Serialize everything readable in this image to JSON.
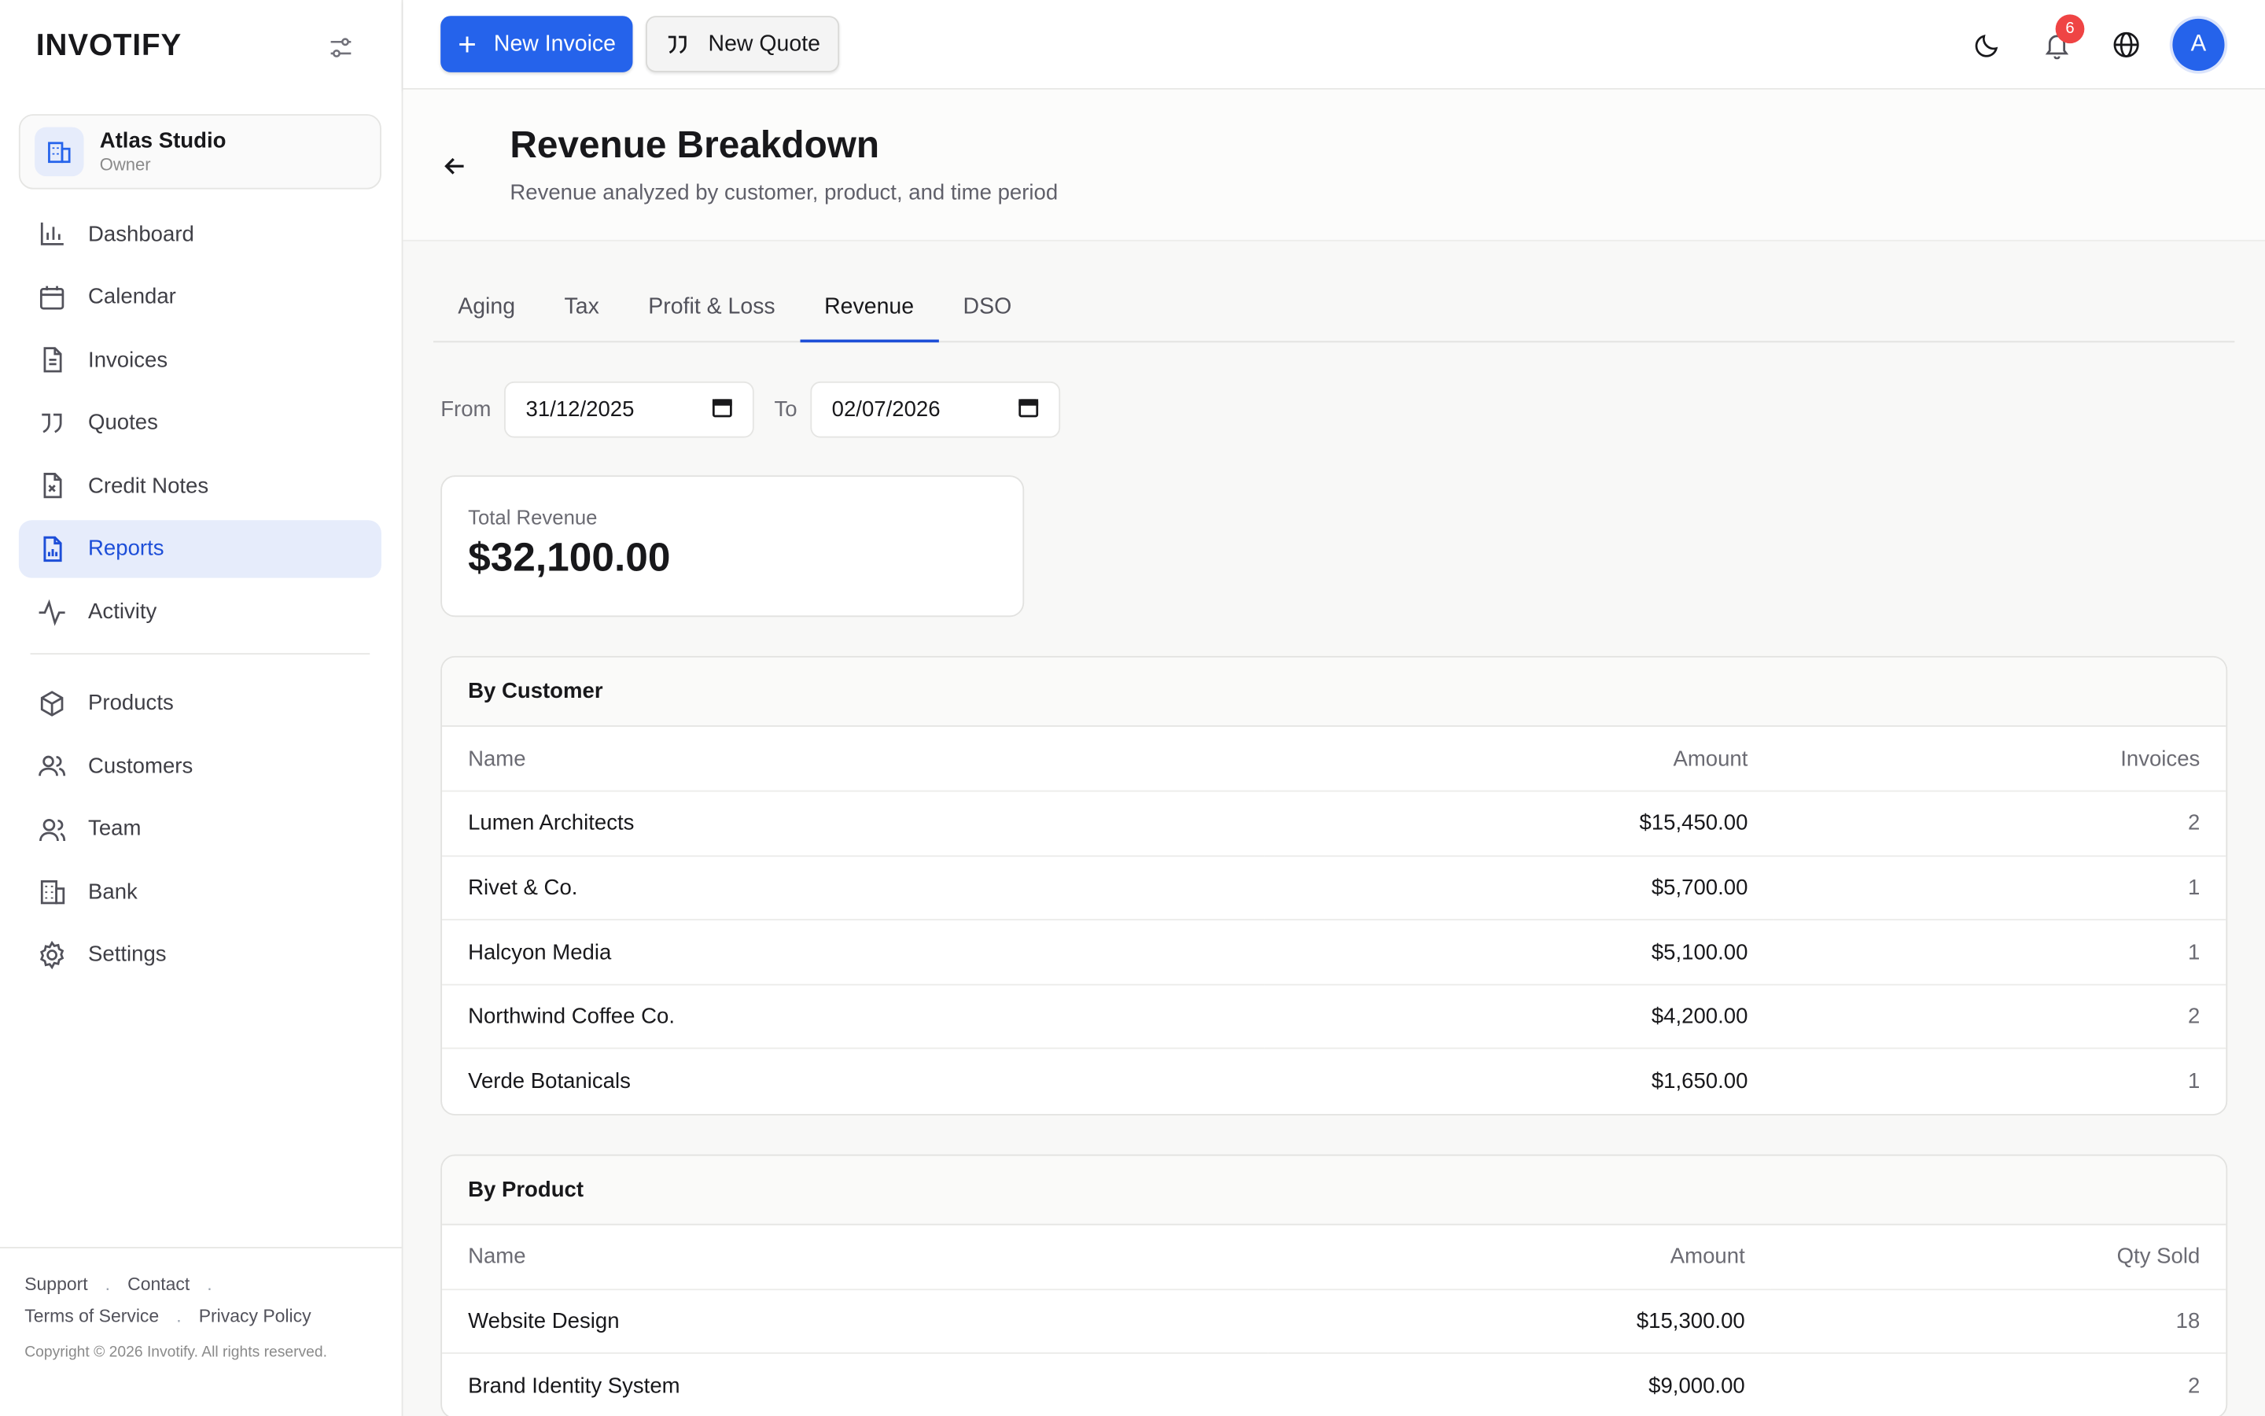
{
  "app": {
    "brand": "INVOTIFY"
  },
  "org": {
    "name": "Atlas Studio",
    "role": "Owner"
  },
  "sidebar": {
    "items": [
      {
        "label": "Dashboard",
        "icon": "bar-chart-icon"
      },
      {
        "label": "Calendar",
        "icon": "calendar-icon"
      },
      {
        "label": "Invoices",
        "icon": "file-text-icon"
      },
      {
        "label": "Quotes",
        "icon": "quote-icon"
      },
      {
        "label": "Credit Notes",
        "icon": "file-x-icon"
      },
      {
        "label": "Reports",
        "icon": "report-icon",
        "active": true
      },
      {
        "label": "Activity",
        "icon": "activity-icon"
      }
    ],
    "items2": [
      {
        "label": "Products",
        "icon": "package-icon"
      },
      {
        "label": "Customers",
        "icon": "users-icon"
      },
      {
        "label": "Team",
        "icon": "team-icon"
      },
      {
        "label": "Bank",
        "icon": "building-icon"
      },
      {
        "label": "Settings",
        "icon": "gear-icon"
      }
    ],
    "footer": {
      "support": "Support",
      "contact": "Contact",
      "terms": "Terms of Service",
      "privacy": "Privacy Policy",
      "sep": ".",
      "copyright": "Copyright © 2026 Invotify. All rights reserved."
    }
  },
  "topbar": {
    "new_invoice": "New Invoice",
    "new_quote": "New Quote",
    "notification_count": "6",
    "avatar_initial": "A"
  },
  "header": {
    "title": "Revenue Breakdown",
    "subtitle": "Revenue analyzed by customer, product, and time period"
  },
  "tabs": [
    {
      "label": "Aging"
    },
    {
      "label": "Tax"
    },
    {
      "label": "Profit & Loss"
    },
    {
      "label": "Revenue",
      "active": true
    },
    {
      "label": "DSO"
    }
  ],
  "filters": {
    "from_label": "From",
    "from_value": "31/12/2025",
    "to_label": "To",
    "to_value": "02/07/2026"
  },
  "summary": {
    "label": "Total Revenue",
    "value": "$32,100.00"
  },
  "by_customer": {
    "title": "By Customer",
    "columns": [
      "Name",
      "Amount",
      "Invoices"
    ],
    "rows": [
      [
        "Lumen Architects",
        "$15,450.00",
        "2"
      ],
      [
        "Rivet & Co.",
        "$5,700.00",
        "1"
      ],
      [
        "Halcyon Media",
        "$5,100.00",
        "1"
      ],
      [
        "Northwind Coffee Co.",
        "$4,200.00",
        "2"
      ],
      [
        "Verde Botanicals",
        "$1,650.00",
        "1"
      ]
    ]
  },
  "by_product": {
    "title": "By Product",
    "columns": [
      "Name",
      "Amount",
      "Qty Sold"
    ],
    "rows": [
      [
        "Website Design",
        "$15,300.00",
        "18"
      ],
      [
        "Brand Identity System",
        "$9,000.00",
        "2"
      ]
    ]
  },
  "colors": {
    "accent": "#2563eb",
    "active_bg": "#e6ecfb",
    "badge": "#ef4444"
  }
}
